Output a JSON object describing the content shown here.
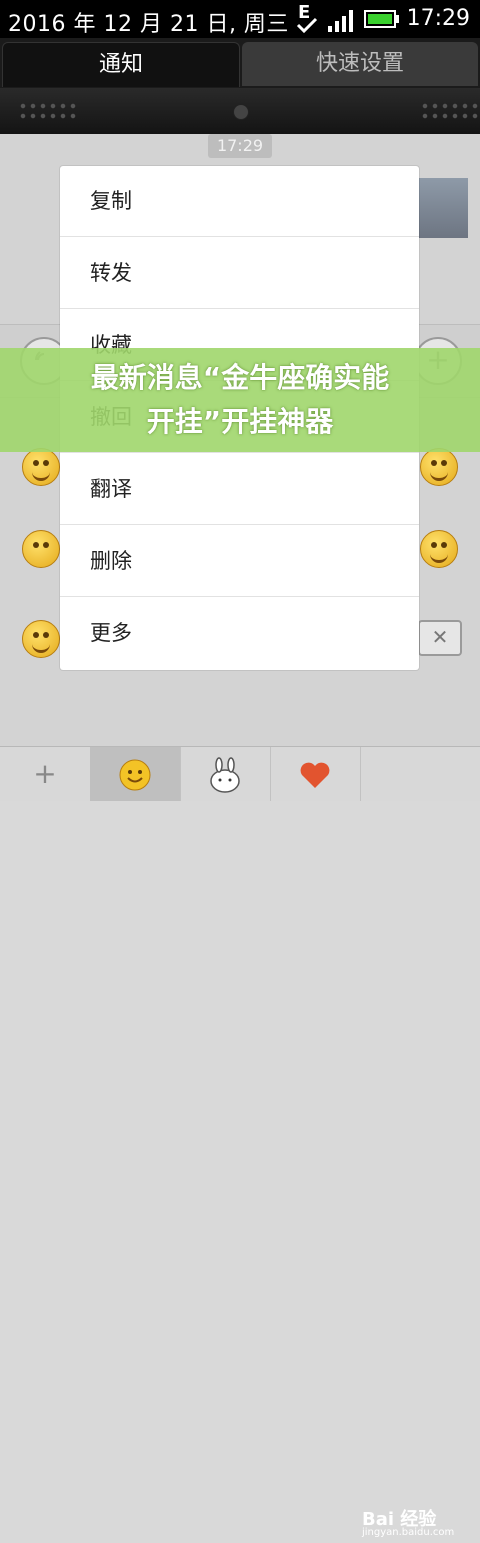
{
  "status_bar": {
    "date": "2016 年 12 月 21 日, 周三",
    "time": "17:29",
    "icons": [
      "edge-icon",
      "check-icon",
      "signal-icon",
      "battery-icon"
    ],
    "battery_color": "#3ad12e"
  },
  "tabs": [
    {
      "label": "通知",
      "active": true
    },
    {
      "label": "快速设置",
      "active": false
    }
  ],
  "chat": {
    "timestamp": "17:29"
  },
  "context_menu": {
    "items": [
      {
        "label": "复制"
      },
      {
        "label": "转发"
      },
      {
        "label": "收藏"
      },
      {
        "label": "撤回"
      },
      {
        "label": "翻译"
      },
      {
        "label": "删除"
      },
      {
        "label": "更多"
      }
    ]
  },
  "banner": {
    "line1": "最新消息“金牛座确实能",
    "line2": "开挂”开挂神器"
  },
  "bottom_bar": {
    "items": [
      "plus-icon",
      "emoji-icon",
      "rabbit-icon",
      "heart-icon"
    ]
  },
  "watermark": {
    "text": "Bai 经验",
    "sub": "jingyan.baidu.com"
  },
  "colors": {
    "banner": "#a0d66c",
    "status_bar_bg": "#000000",
    "heart": "#e2542f"
  }
}
